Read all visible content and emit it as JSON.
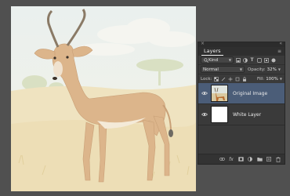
{
  "panel": {
    "close": "×",
    "collapse": "«",
    "tab": "Layers",
    "menu": "≡"
  },
  "filter": {
    "kind_label": "Kind",
    "search_icon": "search-icon"
  },
  "blend": {
    "mode": "Normal",
    "opacity_label": "Opacity:",
    "opacity_value": "32%"
  },
  "lock": {
    "label": "Lock:",
    "fill_label": "Fill:",
    "fill_value": "100%"
  },
  "layers": [
    {
      "name": "Original Image",
      "selected": true,
      "visible": true
    },
    {
      "name": "White Layer",
      "selected": false,
      "visible": true
    }
  ],
  "bottom_icons": [
    "link-icon",
    "fx-icon",
    "mask-icon",
    "adjustment-icon",
    "folder-icon",
    "new-layer-icon",
    "trash-icon"
  ],
  "bottom_labels": {
    "fx": "fx"
  },
  "colors": {
    "panel_bg": "#3a3a3a",
    "selected_row": "#4b5d78",
    "sky": "#eef0e9",
    "grass": "#efe3c2",
    "antelope": "#dcb58b"
  }
}
